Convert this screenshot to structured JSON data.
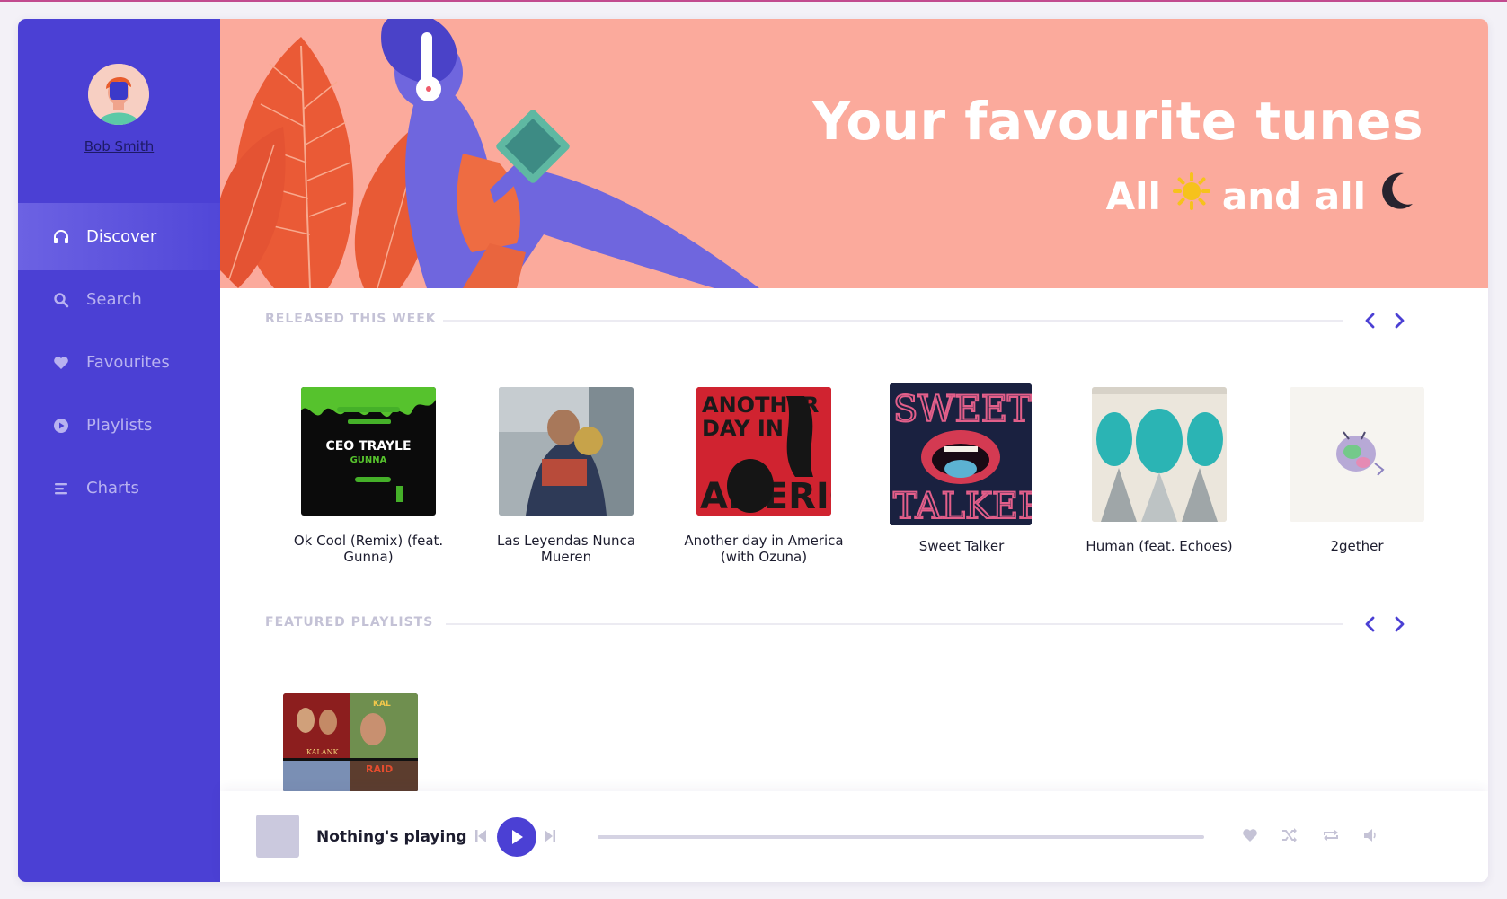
{
  "user": {
    "name": "Bob Smith"
  },
  "nav": {
    "items": [
      {
        "label": "Discover",
        "icon": "headphones-icon",
        "active": true
      },
      {
        "label": "Search",
        "icon": "search-icon",
        "active": false
      },
      {
        "label": "Favourites",
        "icon": "heart-icon",
        "active": false
      },
      {
        "label": "Playlists",
        "icon": "play-circle-icon",
        "active": false
      },
      {
        "label": "Charts",
        "icon": "bars-icon",
        "active": false
      }
    ]
  },
  "hero": {
    "title": "Your favourite tunes",
    "subtitle_part1": "All",
    "subtitle_part2": "and all",
    "sun_icon": "sun-icon",
    "moon_icon": "moon-icon"
  },
  "released": {
    "title": "RELEASED THIS WEEK",
    "items": [
      {
        "title": "Ok Cool (Remix) (feat. Gunna)"
      },
      {
        "title": "Las Leyendas Nunca Mueren"
      },
      {
        "title": "Another day in America (with Ozuna)"
      },
      {
        "title": "Sweet Talker"
      },
      {
        "title": "Human (feat. Echoes)"
      },
      {
        "title": "2gether"
      }
    ]
  },
  "featured": {
    "title": "FEATURED PLAYLISTS"
  },
  "player": {
    "now_playing": "Nothing's playing"
  },
  "colors": {
    "sidebar": "#4b40d4",
    "accent": "#4b40d4",
    "hero_bg": "#fbaa9c",
    "muted": "#c4c2d6"
  }
}
